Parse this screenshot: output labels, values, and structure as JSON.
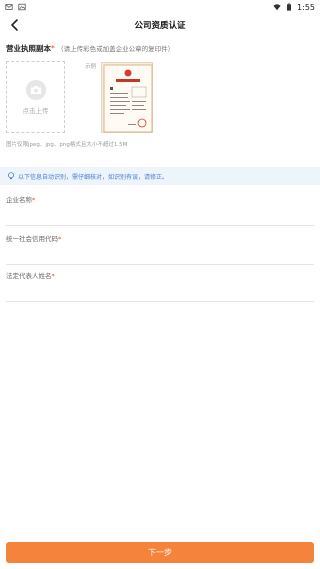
{
  "status_bar": {
    "time": "1:55",
    "icons": [
      "email-icon",
      "photo-icon",
      "wifi-icon",
      "battery-icon"
    ]
  },
  "nav": {
    "title": "公司资质认证"
  },
  "license_section": {
    "title": "营业执照副本",
    "required_mark": "*",
    "hint": "（请上传彩色或加盖企业公章的复印件）",
    "upload_label": "点击上传",
    "example_label": "示例",
    "format_note": "图片仅限jpeg、jpg、png格式且大小不超过1.5M"
  },
  "info": {
    "text": "以下信息自动识别，需仔细核对，如识别有误，请修正。"
  },
  "fields": [
    {
      "label": "企业名称",
      "required": "*",
      "value": ""
    },
    {
      "label": "统一社会信用代码",
      "required": "*",
      "value": ""
    },
    {
      "label": "法定代表人姓名",
      "required": "*",
      "value": ""
    }
  ],
  "next_button": {
    "label": "下一步"
  },
  "colors": {
    "accent": "#f5833b",
    "info_bg": "#eef4fc",
    "info_text": "#4a7fd0",
    "required": "#e5462d"
  }
}
